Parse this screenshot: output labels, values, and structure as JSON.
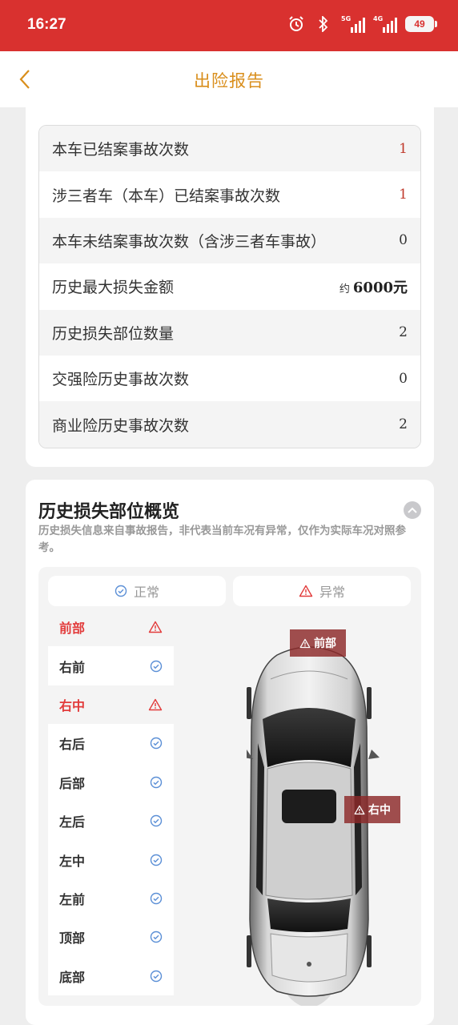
{
  "status_bar": {
    "time": "16:27",
    "network_1": "5G",
    "network_2": "4G",
    "battery": "49"
  },
  "header": {
    "title": "出险报告",
    "back_icon": "chevron-left-icon"
  },
  "accident_stats": [
    {
      "label": "本车已结案事故次数",
      "value": "1",
      "highlight": true
    },
    {
      "label": "涉三者车（本车）已结案事故次数",
      "value": "1",
      "highlight": true
    },
    {
      "label": "本车未结案事故次数（含涉三者车事故）",
      "value": "0",
      "highlight": false
    },
    {
      "label": "历史最大损失金额",
      "prefix": "约",
      "value": "6000元",
      "highlight": false
    },
    {
      "label": "历史损失部位数量",
      "value": "2",
      "highlight": false
    },
    {
      "label": "交强险历史事故次数",
      "value": "0",
      "highlight": false
    },
    {
      "label": "商业险历史事故次数",
      "value": "2",
      "highlight": false
    }
  ],
  "damage_overview": {
    "title": "历史损失部位概览",
    "note": "历史损失信息来自事故报告，非代表当前车况有异常，仅作为实际车况对照参考。",
    "legend_normal": "正常",
    "legend_abnormal": "异常",
    "parts": [
      {
        "name": "前部",
        "status": "abnormal"
      },
      {
        "name": "右前",
        "status": "normal"
      },
      {
        "name": "右中",
        "status": "abnormal"
      },
      {
        "name": "右后",
        "status": "normal"
      },
      {
        "name": "后部",
        "status": "normal"
      },
      {
        "name": "左后",
        "status": "normal"
      },
      {
        "name": "左中",
        "status": "normal"
      },
      {
        "name": "左前",
        "status": "normal"
      },
      {
        "name": "顶部",
        "status": "normal"
      },
      {
        "name": "底部",
        "status": "normal"
      }
    ],
    "car_tags": {
      "front": "前部",
      "right_middle": "右中"
    }
  },
  "colors": {
    "status_bar": "#d9312f",
    "title": "#d98e1b",
    "abnormal": "#e23b3b",
    "normal_icon": "#5b8fd6"
  }
}
